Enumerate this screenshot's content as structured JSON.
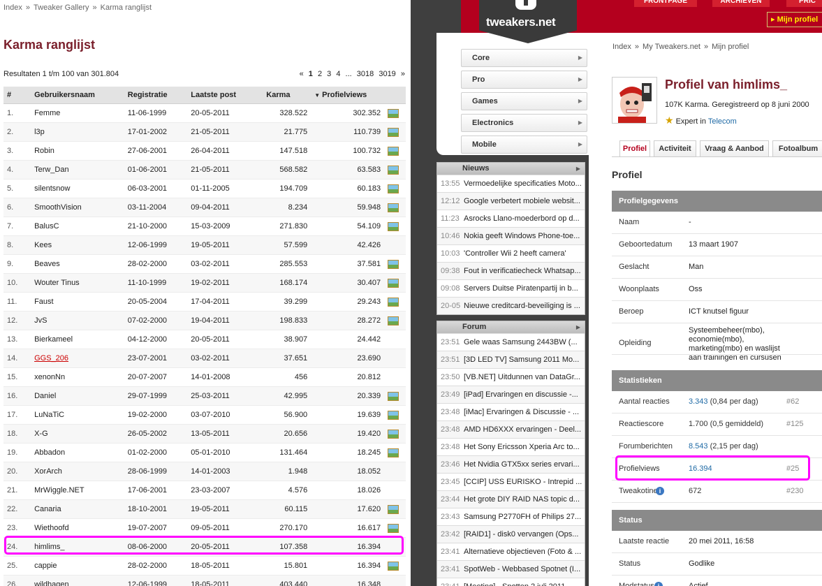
{
  "left": {
    "breadcrumb": [
      "Index",
      "Tweaker Gallery",
      "Karma ranglijst"
    ],
    "breadcrumb_sep": "»",
    "title": "Karma ranglijst",
    "results": "Resultaten 1 t/m 100 van 301.804",
    "pager": {
      "prev": "«",
      "pages": [
        "1",
        "2",
        "3",
        "4"
      ],
      "current": "1",
      "ellipsis": "...",
      "last_pages": [
        "3018",
        "3019"
      ],
      "next": "»"
    },
    "columns": [
      "#",
      "Gebruikersnaam",
      "Registratie",
      "Laatste post",
      "Karma",
      "Profielviews"
    ],
    "sort_column": "Profielviews",
    "rows": [
      {
        "rank": "1.",
        "name": "Femme",
        "reg": "11-06-1999",
        "last": "20-05-2011",
        "karma": "328.522",
        "views": "302.352",
        "pic": true
      },
      {
        "rank": "2.",
        "name": "l3p",
        "reg": "17-01-2002",
        "last": "21-05-2011",
        "karma": "21.775",
        "views": "110.739",
        "pic": true
      },
      {
        "rank": "3.",
        "name": "Robin",
        "reg": "27-06-2001",
        "last": "26-04-2011",
        "karma": "147.518",
        "views": "100.732",
        "pic": true
      },
      {
        "rank": "4.",
        "name": "Terw_Dan",
        "reg": "01-06-2001",
        "last": "21-05-2011",
        "karma": "568.582",
        "views": "63.583",
        "pic": true
      },
      {
        "rank": "5.",
        "name": "silentsnow",
        "reg": "06-03-2001",
        "last": "01-11-2005",
        "karma": "194.709",
        "views": "60.183",
        "pic": true
      },
      {
        "rank": "6.",
        "name": "SmoothVision",
        "reg": "03-11-2004",
        "last": "09-04-2011",
        "karma": "8.234",
        "views": "59.948",
        "pic": true
      },
      {
        "rank": "7.",
        "name": "BalusC",
        "reg": "21-10-2000",
        "last": "15-03-2009",
        "karma": "271.830",
        "views": "54.109",
        "pic": true
      },
      {
        "rank": "8.",
        "name": "Kees",
        "reg": "12-06-1999",
        "last": "19-05-2011",
        "karma": "57.599",
        "views": "42.426",
        "pic": false
      },
      {
        "rank": "9.",
        "name": "Beaves",
        "reg": "28-02-2000",
        "last": "03-02-2011",
        "karma": "285.553",
        "views": "37.581",
        "pic": true
      },
      {
        "rank": "10.",
        "name": "Wouter Tinus",
        "reg": "11-10-1999",
        "last": "19-02-2011",
        "karma": "168.174",
        "views": "30.407",
        "pic": true
      },
      {
        "rank": "11.",
        "name": "Faust",
        "reg": "20-05-2004",
        "last": "17-04-2011",
        "karma": "39.299",
        "views": "29.243",
        "pic": true
      },
      {
        "rank": "12.",
        "name": "JvS",
        "reg": "07-02-2000",
        "last": "19-04-2011",
        "karma": "198.833",
        "views": "28.272",
        "pic": true
      },
      {
        "rank": "13.",
        "name": "Bierkameel",
        "reg": "04-12-2000",
        "last": "20-05-2011",
        "karma": "38.907",
        "views": "24.442",
        "pic": false
      },
      {
        "rank": "14.",
        "name": "GGS_206",
        "reg": "23-07-2001",
        "last": "03-02-2011",
        "karma": "37.651",
        "views": "23.690",
        "pic": false,
        "red": true
      },
      {
        "rank": "15.",
        "name": "xenonNn",
        "reg": "20-07-2007",
        "last": "14-01-2008",
        "karma": "456",
        "views": "20.812",
        "pic": false
      },
      {
        "rank": "16.",
        "name": "Daniel",
        "reg": "29-07-1999",
        "last": "25-03-2011",
        "karma": "42.995",
        "views": "20.339",
        "pic": true
      },
      {
        "rank": "17.",
        "name": "LuNaTiC",
        "reg": "19-02-2000",
        "last": "03-07-2010",
        "karma": "56.900",
        "views": "19.639",
        "pic": true
      },
      {
        "rank": "18.",
        "name": "X-G",
        "reg": "26-05-2002",
        "last": "13-05-2011",
        "karma": "20.656",
        "views": "19.420",
        "pic": true
      },
      {
        "rank": "19.",
        "name": "Abbadon",
        "reg": "01-02-2000",
        "last": "05-01-2010",
        "karma": "131.464",
        "views": "18.245",
        "pic": true
      },
      {
        "rank": "20.",
        "name": "XorArch",
        "reg": "28-06-1999",
        "last": "14-01-2003",
        "karma": "1.948",
        "views": "18.052",
        "pic": false
      },
      {
        "rank": "21.",
        "name": "MrWiggle.NET",
        "reg": "17-06-2001",
        "last": "23-03-2007",
        "karma": "4.576",
        "views": "18.026",
        "pic": false
      },
      {
        "rank": "22.",
        "name": "Canaria",
        "reg": "18-10-2001",
        "last": "19-05-2011",
        "karma": "60.115",
        "views": "17.620",
        "pic": true
      },
      {
        "rank": "23.",
        "name": "Wiethoofd",
        "reg": "19-07-2007",
        "last": "09-05-2011",
        "karma": "270.170",
        "views": "16.617",
        "pic": true
      },
      {
        "rank": "24.",
        "name": "himlims_",
        "reg": "08-06-2000",
        "last": "20-05-2011",
        "karma": "107.358",
        "views": "16.394",
        "pic": false
      },
      {
        "rank": "25.",
        "name": "cappie",
        "reg": "28-02-2000",
        "last": "18-05-2011",
        "karma": "15.801",
        "views": "16.394",
        "pic": true
      },
      {
        "rank": "26.",
        "name": "wildhagen",
        "reg": "12-06-1999",
        "last": "18-05-2011",
        "karma": "403.440",
        "views": "16.348",
        "pic": false
      }
    ]
  },
  "right": {
    "topnav": [
      "FRONTPAGE",
      "ARCHIEVEN",
      "PRIC"
    ],
    "logo": "tweakers.net",
    "mijn_profiel": "Mijn profiel",
    "menu": [
      "Core",
      "Pro",
      "Games",
      "Electronics",
      "Mobile"
    ],
    "nieuws": {
      "title": "Nieuws",
      "items": [
        {
          "time": "13:55",
          "title": "Vermoedelijke specificaties Moto..."
        },
        {
          "time": "12:12",
          "title": "Google verbetert mobiele websit..."
        },
        {
          "time": "11:23",
          "title": "Asrocks Llano-moederbord op d..."
        },
        {
          "time": "10:46",
          "title": "Nokia geeft Windows Phone-toe..."
        },
        {
          "time": "10:03",
          "title": "'Controller Wii 2 heeft camera'"
        },
        {
          "time": "09:38",
          "title": "Fout in verificatiecheck Whatsap..."
        },
        {
          "time": "09:08",
          "title": "Servers Duitse Piratenpartij in b..."
        },
        {
          "time": "20-05",
          "title": "Nieuwe creditcard-beveiliging is ..."
        }
      ]
    },
    "forum": {
      "title": "Forum",
      "items": [
        {
          "time": "23:51",
          "title": "Gele waas Samsung 2443BW (..."
        },
        {
          "time": "23:51",
          "title": "[3D LED TV] Samsung 2011 Mo..."
        },
        {
          "time": "23:50",
          "title": "[VB.NET] Uitdunnen van DataGr..."
        },
        {
          "time": "23:49",
          "title": "[iPad] Ervaringen en discussie -..."
        },
        {
          "time": "23:48",
          "title": "[iMac] Ervaringen & Discussie - ..."
        },
        {
          "time": "23:48",
          "title": "AMD HD6XXX ervaringen - Deel..."
        },
        {
          "time": "23:48",
          "title": "Het Sony Ericsson Xperia Arc to..."
        },
        {
          "time": "23:46",
          "title": "Het Nvidia GTX5xx series ervari..."
        },
        {
          "time": "23:45",
          "title": "[CCIP] USS EURISKO - Intrepid ..."
        },
        {
          "time": "23:44",
          "title": "Het grote DIY RAID NAS topic d..."
        },
        {
          "time": "23:43",
          "title": "Samsung P2770FH of Philips 27..."
        },
        {
          "time": "23:42",
          "title": "[RAID1] - disk0 vervangen (Ops..."
        },
        {
          "time": "23:41",
          "title": "Alternatieve objectieven (Foto & ..."
        },
        {
          "time": "23:41",
          "title": "SpotWeb - Webbased Spotnet (I..."
        },
        {
          "time": "23:41",
          "title": "[Meeting] - Spotten 2 juli 2011..."
        }
      ]
    },
    "breadcrumb": [
      "Index",
      "My Tweakers.net",
      "Mijn profiel"
    ],
    "breadcrumb_sep": "»",
    "profile_title": "Profiel van himlims_",
    "karma_line": "107K Karma. Geregistreerd op 8 juni 2000",
    "expert_prefix": "Expert in",
    "expert_topic": "Telecom",
    "tabs": [
      "Profiel",
      "Activiteit",
      "Vraag & Aanbod",
      "Fotoalbum"
    ],
    "active_tab": "Profiel",
    "section_title": "Profiel",
    "profielgegevens": {
      "title": "Profielgegevens",
      "rows": [
        {
          "k": "Naam",
          "v": "-"
        },
        {
          "k": "Geboortedatum",
          "v": "13 maart 1907"
        },
        {
          "k": "Geslacht",
          "v": "Man"
        },
        {
          "k": "Woonplaats",
          "v": "Oss"
        },
        {
          "k": "Beroep",
          "v": "ICT knutsel figuur"
        },
        {
          "k": "Opleiding",
          "v": "Systeembeheer(mbo), economie(mbo), marketing(mbo) en waslijst aan trainingen en cursusen"
        }
      ]
    },
    "statistieken": {
      "title": "Statistieken",
      "rows": [
        {
          "k": "Aantal reacties",
          "link": "3.343",
          "rest": " (0,84 per dag)",
          "rank": "#62"
        },
        {
          "k": "Reactiescore",
          "link": "",
          "rest": "1.700 (0,5 gemiddeld)",
          "rank": "#125"
        },
        {
          "k": "Forumberichten",
          "link": "8.543",
          "rest": " (2,15 per dag)",
          "rank": ""
        },
        {
          "k": "Profielviews",
          "link": "16.394",
          "rest": "",
          "rank": "#25"
        },
        {
          "k": "Tweakotine",
          "link": "",
          "rest": "672",
          "rank": "#230",
          "info": true
        }
      ]
    },
    "status": {
      "title": "Status",
      "rows": [
        {
          "k": "Laatste reactie",
          "v": "20 mei 2011, 16:58"
        },
        {
          "k": "Status",
          "v": "Godlike"
        },
        {
          "k": "Modstatus",
          "v": "Actief",
          "info": true
        }
      ]
    }
  }
}
